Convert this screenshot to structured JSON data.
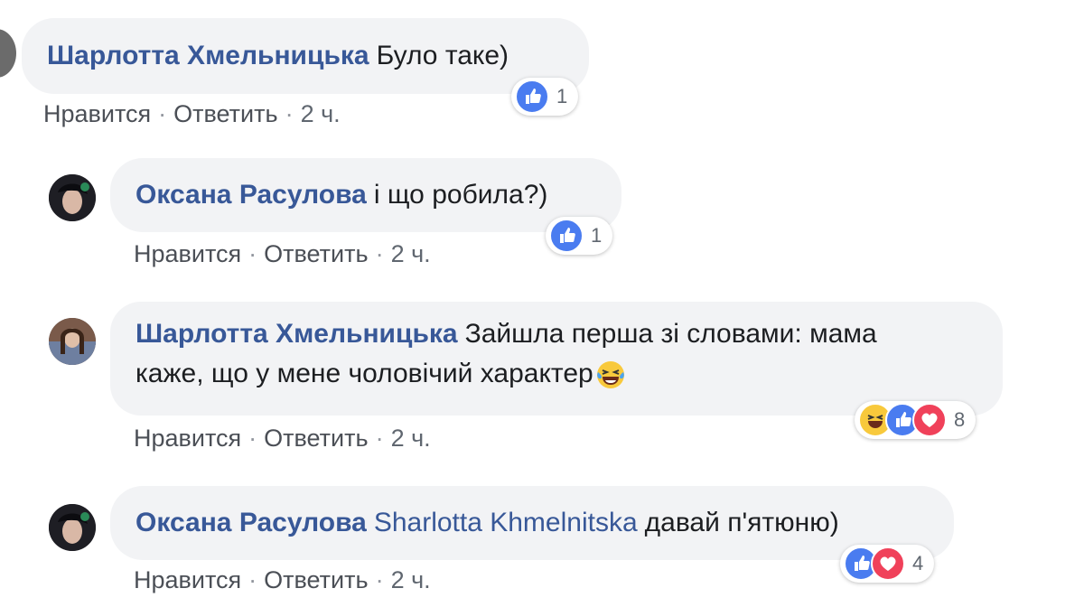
{
  "comments": [
    {
      "author": "Шарлотта Хмельницька",
      "text": "Було таке)",
      "actions": {
        "like": "Нравится",
        "reply": "Ответить",
        "time": "2 ч."
      },
      "reactions": {
        "types": [
          "like"
        ],
        "count": "1"
      }
    },
    {
      "author": "Оксана Расулова",
      "text": "і що робила?)",
      "actions": {
        "like": "Нравится",
        "reply": "Ответить",
        "time": "2 ч."
      },
      "reactions": {
        "types": [
          "like"
        ],
        "count": "1"
      }
    },
    {
      "author": "Шарлотта Хмельницька",
      "text_line1": "Зайшла перша зі словами: мама",
      "text_line2": "каже, що у мене чоловічий характер",
      "actions": {
        "like": "Нравится",
        "reply": "Ответить",
        "time": "2 ч."
      },
      "reactions": {
        "types": [
          "haha",
          "like",
          "love"
        ],
        "count": "8"
      }
    },
    {
      "author": "Оксана Расулова",
      "mention": "Sharlotta Khmelnitska",
      "text": "давай п'ятюню)",
      "actions": {
        "like": "Нравится",
        "reply": "Ответить",
        "time": "2 ч."
      },
      "reactions": {
        "types": [
          "like",
          "love"
        ],
        "count": "4"
      }
    }
  ],
  "separator": "·",
  "colors": {
    "author": "#385898",
    "bubble": "#f2f3f5",
    "like": "#4a7cf0",
    "love": "#f0415a",
    "haha": "#f8c93c"
  }
}
